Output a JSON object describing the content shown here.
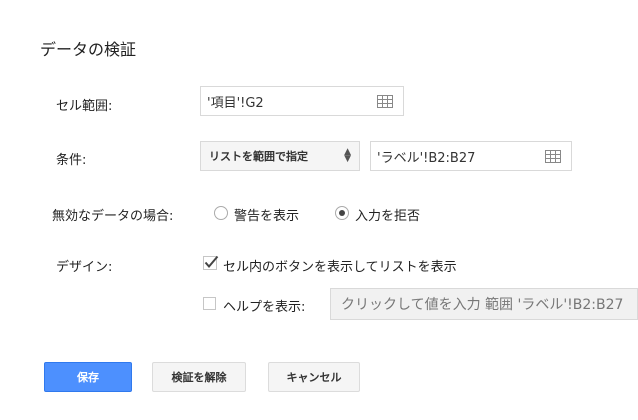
{
  "dialog": {
    "title": "データの検証"
  },
  "cell_range": {
    "label": "セル範囲:",
    "value": "'項目'!G2",
    "icon": "grid-icon"
  },
  "criteria": {
    "label": "条件:",
    "type_select": "リストを範囲で指定",
    "range_value": "'ラベル'!B2:B27",
    "icon": "grid-icon"
  },
  "invalid_data": {
    "label": "無効なデータの場合:",
    "options": [
      {
        "label": "警告を表示",
        "selected": false
      },
      {
        "label": "入力を拒否",
        "selected": true
      }
    ]
  },
  "design": {
    "label": "デザイン:",
    "show_button_checkbox": {
      "label": "セル内のボタンを表示してリストを表示",
      "checked": true
    },
    "help_checkbox": {
      "label": "ヘルプを表示:",
      "checked": false
    },
    "help_text": "クリックして値を入力 範囲 'ラベル'!B2:B27"
  },
  "buttons": {
    "save": "保存",
    "remove": "検証を解除",
    "cancel": "キャンセル"
  },
  "colors": {
    "primary": "#4d90fe",
    "checkmark": "#444444"
  }
}
